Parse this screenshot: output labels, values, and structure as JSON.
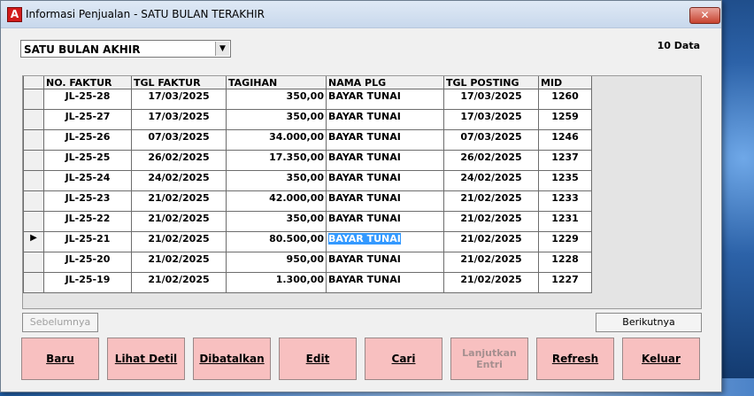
{
  "window": {
    "title": "Informasi Penjualan - SATU BULAN TERAKHIR",
    "app_icon": "A",
    "close_icon": "close-icon"
  },
  "filter": {
    "value": "SATU BULAN AKHIR"
  },
  "count_label": "10 Data",
  "table": {
    "headers": [
      "NO. FAKTUR",
      "TGL FAKTUR",
      "TAGIHAN",
      "NAMA PLG",
      "TGL POSTING",
      "MID"
    ],
    "rows": [
      [
        "JL-25-28",
        "17/03/2025",
        "350,00",
        "BAYAR TUNAI",
        "17/03/2025",
        "1260"
      ],
      [
        "JL-25-27",
        "17/03/2025",
        "350,00",
        "BAYAR TUNAI",
        "17/03/2025",
        "1259"
      ],
      [
        "JL-25-26",
        "07/03/2025",
        "34.000,00",
        "BAYAR TUNAI",
        "07/03/2025",
        "1246"
      ],
      [
        "JL-25-25",
        "26/02/2025",
        "17.350,00",
        "BAYAR TUNAI",
        "26/02/2025",
        "1237"
      ],
      [
        "JL-25-24",
        "24/02/2025",
        "350,00",
        "BAYAR TUNAI",
        "24/02/2025",
        "1235"
      ],
      [
        "JL-25-23",
        "21/02/2025",
        "42.000,00",
        "BAYAR TUNAI",
        "21/02/2025",
        "1233"
      ],
      [
        "JL-25-22",
        "21/02/2025",
        "350,00",
        "BAYAR TUNAI",
        "21/02/2025",
        "1231"
      ],
      [
        "JL-25-21",
        "21/02/2025",
        "80.500,00",
        "BAYAR TUNAI",
        "21/02/2025",
        "1229"
      ],
      [
        "JL-25-20",
        "21/02/2025",
        "950,00",
        "BAYAR TUNAI",
        "21/02/2025",
        "1228"
      ],
      [
        "JL-25-19",
        "21/02/2025",
        "1.300,00",
        "BAYAR TUNAI",
        "21/02/2025",
        "1227"
      ]
    ],
    "selected_row": 7,
    "row_indicator": "▶"
  },
  "pager": {
    "prev": "Sebelumnya",
    "next": "Berikutnya"
  },
  "buttons": {
    "baru": "Baru",
    "lihat_detil": "Lihat Detil",
    "dibatalkan": "Dibatalkan",
    "edit": "Edit",
    "cari": "Cari",
    "lanjutkan_entri": "Lanjutkan Entri",
    "refresh": "Refresh",
    "keluar": "Keluar"
  },
  "colors": {
    "button_bg": "#f8c0c0",
    "selection": "#3399ff",
    "close_btn": "#c7432f"
  }
}
